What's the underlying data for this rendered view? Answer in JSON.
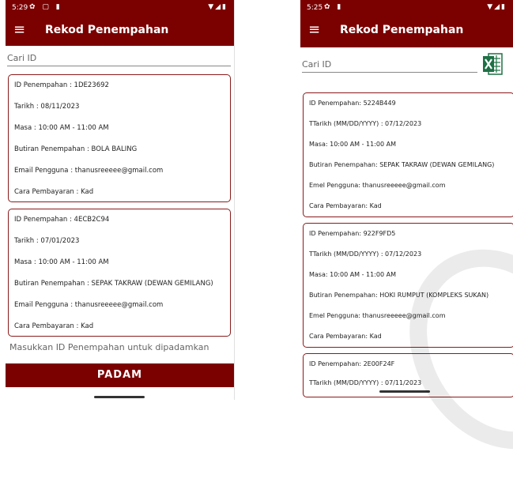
{
  "phone1": {
    "status": {
      "time": "5:29",
      "left_icons": "✿ ▢ ▮",
      "right_icons": "▼◢▮"
    },
    "appbar": {
      "title": "Rekod Penempahan"
    },
    "search": {
      "placeholder": "Cari ID"
    },
    "cards": [
      {
        "lines": [
          "ID Penempahan : 1DE23692",
          "Tarikh : 08/11/2023",
          "Masa : 10:00 AM - 11:00 AM",
          "Butiran Penempahan : BOLA BALING",
          "Email Pengguna : thanusreeeee@gmail.com",
          "Cara Pembayaran : Kad"
        ]
      },
      {
        "lines": [
          "ID Penempahan : 4ECB2C94",
          "Tarikh : 07/01/2023",
          "Masa : 10:00 AM - 11:00 AM",
          "Butiran Penempahan : SEPAK TAKRAW (DEWAN GEMILANG)",
          "Email Pengguna : thanusreeeee@gmail.com",
          "Cara Pembayaran : Kad"
        ]
      }
    ],
    "delete_hint": "Masukkan ID Penempahan untuk dipadamkan",
    "delete_button": "PADAM"
  },
  "phone2": {
    "status": {
      "time": "5:25",
      "left_icons": "✿ ▮",
      "right_icons": "▼◢▮"
    },
    "appbar": {
      "title": "Rekod Penempahan"
    },
    "search": {
      "placeholder": "Cari ID"
    },
    "excel_icon": "excel-icon",
    "cards": [
      {
        "lines": [
          "ID Penempahan: 5224B449",
          "TTarikh (MM/DD/YYYY) : 07/12/2023",
          "Masa: 10:00 AM - 11:00 AM",
          "Butiran Penempahan: SEPAK TAKRAW (DEWAN GEMILANG)",
          "Emel Pengguna: thanusreeeee@gmail.com",
          "Cara Pembayaran: Kad"
        ]
      },
      {
        "lines": [
          "ID Penempahan: 922F9FD5",
          "TTarikh (MM/DD/YYYY) : 07/12/2023",
          "Masa: 10:00 AM - 11:00 AM",
          "Butiran Penempahan: HOKI RUMPUT (KOMPLEKS SUKAN)",
          "Emel Pengguna: thanusreeeee@gmail.com",
          "Cara Pembayaran: Kad"
        ]
      },
      {
        "lines": [
          "ID Penempahan: 2E00F24F",
          "TTarikh (MM/DD/YYYY) : 07/11/2023"
        ]
      }
    ]
  },
  "colors": {
    "primary": "#7b0000",
    "card_border": "#8b1a1a",
    "excel_green": "#1e7145"
  }
}
